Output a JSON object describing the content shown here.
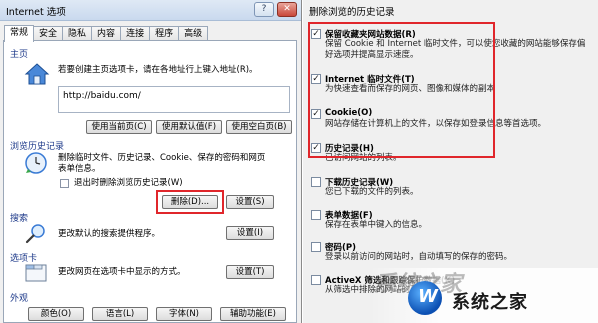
{
  "left": {
    "title": "Internet 选项",
    "title_buttons": [
      "?",
      "✕"
    ],
    "tabs": [
      "常规",
      "安全",
      "隐私",
      "内容",
      "连接",
      "程序",
      "高级"
    ],
    "home": {
      "heading": "主页",
      "desc": "若要创建主页选项卡，请在各地址行上键入地址(R)。",
      "url": "http://baidu.com/",
      "buttons": [
        "使用当前页(C)",
        "使用默认值(F)",
        "使用空白页(B)"
      ]
    },
    "history": {
      "heading": "浏览历史记录",
      "desc_line1": "删除临时文件、历史记录、Cookie、保存的密码和网页",
      "desc_line2": "表单信息。",
      "checkbox_label": "退出时删除浏览历史记录(W)",
      "delete_button": "删除(D)...",
      "settings_button": "设置(S)"
    },
    "search": {
      "heading": "搜索",
      "desc": "更改默认的搜索提供程序。",
      "settings_button": "设置(I)"
    },
    "tabs_section": {
      "heading": "选项卡",
      "desc": "更改网页在选项卡中显示的方式。",
      "settings_button": "设置(T)"
    },
    "appearance": {
      "heading": "外观",
      "buttons": [
        "颜色(O)",
        "语言(L)",
        "字体(N)",
        "辅助功能(E)"
      ]
    }
  },
  "right": {
    "title": "删除浏览的历史记录",
    "items": [
      {
        "checked": true,
        "title": "保留收藏夹网站数据(R)",
        "desc": "保留 Cookie 和 Internet 临时文件，可以使您收藏的网站能够保存偏好选项并提高显示速度。"
      },
      {
        "checked": true,
        "title": "Internet 临时文件(T)",
        "desc": "为快速查看而保存的网页、图像和媒体的副本"
      },
      {
        "checked": true,
        "title": "Cookie(O)",
        "desc": "网站存储在计算机上的文件，以保存如登录信息等首选项。"
      },
      {
        "checked": true,
        "title": "历史记录(H)",
        "desc": "已访问网站的列表。"
      },
      {
        "checked": false,
        "title": "下载历史记录(W)",
        "desc": "您已下载的文件的列表。"
      },
      {
        "checked": false,
        "title": "表单数据(F)",
        "desc": "保存在表单中键入的信息。"
      },
      {
        "checked": false,
        "title": "密码(P)",
        "desc": "登录以前访问的网站时，自动填写的保存的密码。"
      },
      {
        "checked": false,
        "title": "ActiveX 筛选和跟踪保护数据(K)",
        "desc": "从筛选中排除的网站的列表。"
      }
    ]
  },
  "watermark": {
    "logo_letter": "W",
    "text": "系统之家",
    "ghost_text": "系统之家"
  }
}
